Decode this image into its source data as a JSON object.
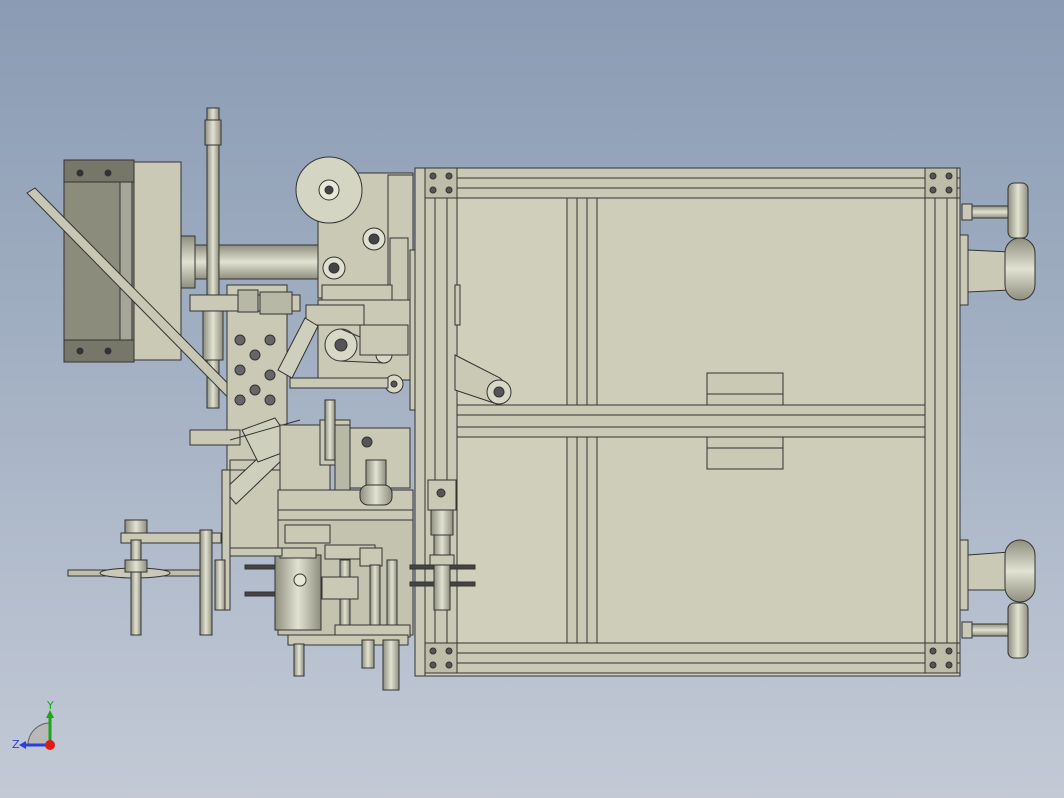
{
  "viewport": {
    "view": "top",
    "background_top": "#8a9bb3",
    "background_bottom": "#c3cad6",
    "model_fill": "#c9c9b6",
    "model_edge": "#333333"
  },
  "triad": {
    "y_label": "Y",
    "z_label": "Z",
    "y_color": "#1aa51a",
    "z_color": "#2b3ee0",
    "x_color": "#e01a1a"
  }
}
